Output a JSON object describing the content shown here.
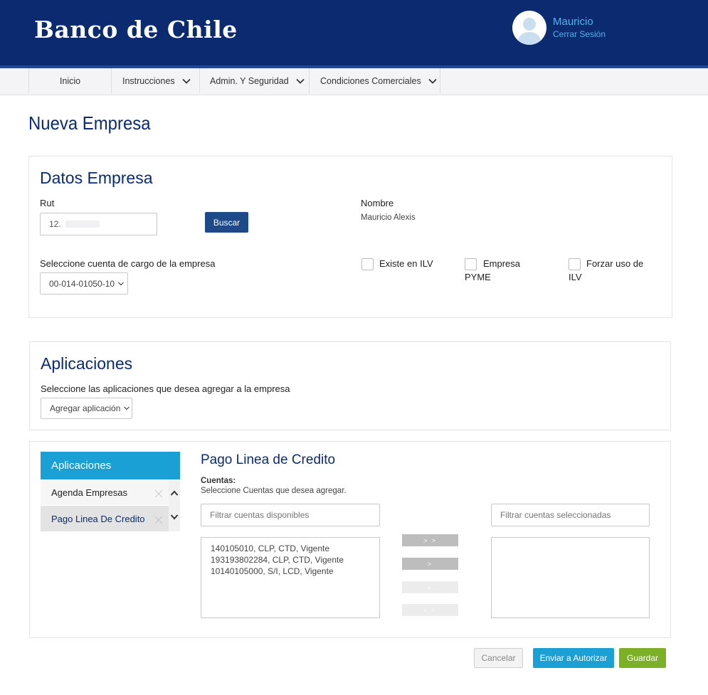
{
  "header": {
    "brand": "Banco de Chile",
    "user_name": "Mauricio",
    "logout_label": "Cerrar Sesión"
  },
  "nav": {
    "items": [
      {
        "label": "Inicio"
      },
      {
        "label": "Instrucciones"
      },
      {
        "label": "Admin. Y Seguridad"
      },
      {
        "label": "Condiciones Comerciales"
      }
    ]
  },
  "page": {
    "title": "Nueva Empresa"
  },
  "datos_empresa": {
    "title": "Datos Empresa",
    "rut_label": "Rut",
    "rut_value": "12.",
    "search_label": "Buscar",
    "name_label": "Nombre",
    "name_value": "Mauricio Alexis",
    "account_label": "Seleccione cuenta de cargo de la empresa",
    "account_selected": "00-014-01050-10",
    "checkboxes": {
      "ilv_label": "Existe en ILV",
      "pyme_label_1": "Empresa",
      "pyme_label_2": "PYME",
      "force_label_1": "Forzar uso de",
      "force_label_2": "ILV"
    }
  },
  "aplicaciones": {
    "title": "Aplicaciones",
    "instruction": "Seleccione las aplicaciones que desea agregar a la empresa",
    "add_label": "Agregar aplicación"
  },
  "app_sidebar": {
    "header": "Aplicaciones",
    "items": [
      {
        "label": "Agenda Empresas"
      },
      {
        "label": "Pago Linea De Credito"
      }
    ]
  },
  "pago_linea": {
    "title": "Pago Linea de Credito",
    "accounts_label": "Cuentas:",
    "accounts_hint": "Seleccione Cuentas que desea agregar.",
    "filter_available_placeholder": "Filtrar cuentas disponibles",
    "filter_selected_placeholder": "Filtrar cuentas seleccionadas",
    "available_accounts": [
      "140105010, CLP, CTD, Vigente",
      "193193802284, CLP, CTD, Vigente",
      "10140105000, S/I, LCD, Vigente"
    ],
    "move_all_right": "> >",
    "move_right": ">",
    "move_left": "<",
    "move_all_left": "< <"
  },
  "footer_buttons": {
    "cancel": "Cancelar",
    "send": "Enviar a Autorizar",
    "save": "Guardar"
  },
  "colors": {
    "brand_blue": "#0b2a6f",
    "accent_cyan": "#1aa0d4",
    "save_green": "#7cb127"
  }
}
